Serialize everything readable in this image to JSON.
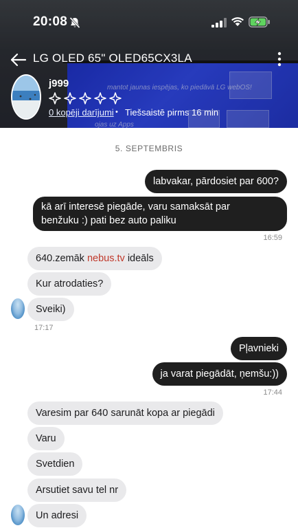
{
  "status_bar": {
    "time": "20:08"
  },
  "header": {
    "title": "LG OLED 65\" OLED65CX3LA",
    "tv_caption": "mantot jaunas iespējas, ko piedāvā LG webOS!",
    "tv_caption2": "ojas uz Apps",
    "seller": {
      "username": "j999",
      "deals_link": "0 kopēji darījumi",
      "separator": "•",
      "online_status": "Tiešsaistē pirms 16 min",
      "stars": 5
    }
  },
  "chat": {
    "date": "5. SEPTEMBRIS",
    "messages": [
      {
        "id": "m1",
        "dir": "out",
        "text": "labvakar, pārdosiet par 600?"
      },
      {
        "id": "m2",
        "dir": "out",
        "text": "kā arī interesē piegāde, varu samaksāt par benžuku :) pati bez auto paliku",
        "time": "16:59"
      },
      {
        "id": "m3",
        "dir": "in",
        "text_before": "640.zemāk ",
        "link": "nebus.tv",
        "text_after": " ideāls"
      },
      {
        "id": "m4",
        "dir": "in",
        "text": "Kur atrodaties?"
      },
      {
        "id": "m5",
        "dir": "in",
        "text": "Sveiki)",
        "time": "17:17"
      },
      {
        "id": "m6",
        "dir": "out",
        "text": "Pļavnieki"
      },
      {
        "id": "m7",
        "dir": "out",
        "text": "ja varat piegādāt, ņemšu:))",
        "time": "17:44"
      },
      {
        "id": "m8",
        "dir": "in",
        "text": "Varesim par 640 sarunāt kopa ar piegādi"
      },
      {
        "id": "m9",
        "dir": "in",
        "text": "Varu"
      },
      {
        "id": "m10",
        "dir": "in",
        "text": "Svetdien"
      },
      {
        "id": "m11",
        "dir": "in",
        "text": "Arsutiet savu tel nr"
      },
      {
        "id": "m12",
        "dir": "in",
        "text": "Un adresi"
      }
    ]
  },
  "colors": {
    "outgoing_bubble": "#1f1f1f",
    "incoming_bubble": "#e9e9eb",
    "link": "#c0392b",
    "battery": "#5fd35f"
  },
  "icons": [
    "bell-slash-icon",
    "signal-icon",
    "wifi-icon",
    "battery-charging-icon",
    "back-arrow-icon",
    "more-vertical-icon",
    "star-icon"
  ]
}
